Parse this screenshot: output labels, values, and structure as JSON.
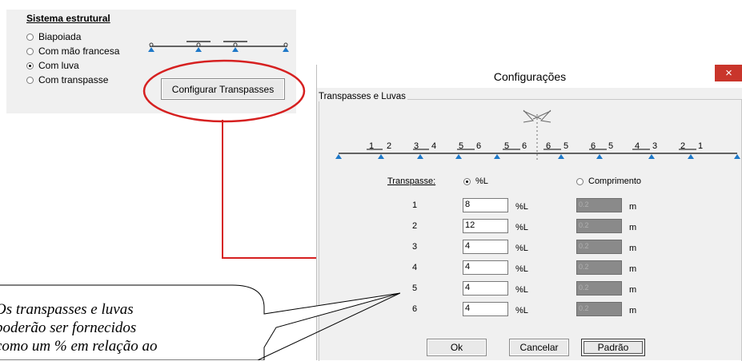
{
  "structure_panel": {
    "title": "Sistema estrutural",
    "options": [
      {
        "label": "Biapoiada",
        "selected": false
      },
      {
        "label": "Com mão francesa",
        "selected": false
      },
      {
        "label": "Com luva",
        "selected": true
      },
      {
        "label": "Com transpasse",
        "selected": false
      }
    ],
    "configure_button": "Configurar Transpasses"
  },
  "dialog": {
    "title": "Configurações",
    "close_glyph": "×",
    "group_label": "Transpasses e Luvas",
    "beam_labels": [
      "1",
      "2",
      "3",
      "4",
      "5",
      "6",
      "5",
      "6",
      "6",
      "5",
      "6",
      "5",
      "4",
      "3",
      "2",
      "1"
    ],
    "transpasse_label": "Transpasse:",
    "mode_percent": {
      "label": "%L",
      "selected": true
    },
    "mode_length": {
      "label": "Comprimento",
      "selected": false
    },
    "rows": [
      {
        "index": "1",
        "percent": "8",
        "unit_pct": "%L",
        "length": "0.2",
        "unit_len": "m"
      },
      {
        "index": "2",
        "percent": "12",
        "unit_pct": "%L",
        "length": "0.2",
        "unit_len": "m"
      },
      {
        "index": "3",
        "percent": "4",
        "unit_pct": "%L",
        "length": "0.2",
        "unit_len": "m"
      },
      {
        "index": "4",
        "percent": "4",
        "unit_pct": "%L",
        "length": "0.2",
        "unit_len": "m"
      },
      {
        "index": "5",
        "percent": "4",
        "unit_pct": "%L",
        "length": "0.2",
        "unit_len": "m"
      },
      {
        "index": "6",
        "percent": "4",
        "unit_pct": "%L",
        "length": "0.2",
        "unit_len": "m"
      }
    ],
    "buttons": {
      "ok": "Ok",
      "cancel": "Cancelar",
      "default": "Padrão"
    }
  },
  "callout": {
    "lines": [
      "Os transpasses e luvas",
      "poderão ser fornecidos",
      "como um % em relação ao"
    ]
  },
  "colors": {
    "highlight": "#d62020",
    "support": "#1e78c8",
    "close": "#c9352b"
  }
}
